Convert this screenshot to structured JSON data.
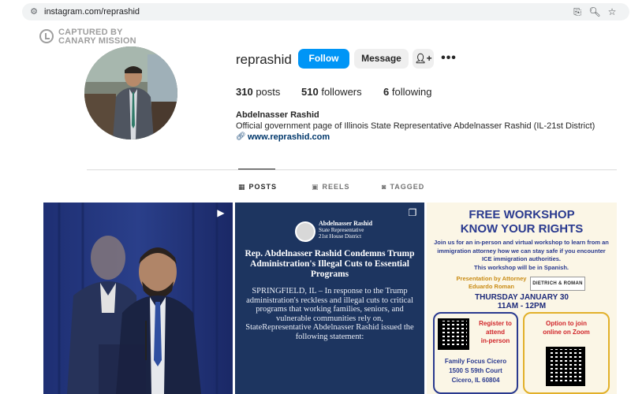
{
  "browser": {
    "url": "instagram.com/reprashid"
  },
  "watermark": {
    "line1": "CAPTURED BY",
    "line2": "CANARY MISSION"
  },
  "profile": {
    "username": "reprashid",
    "follow_label": "Follow",
    "message_label": "Message",
    "posts_count": "310",
    "posts_label": "posts",
    "followers_count": "510",
    "followers_label": "followers",
    "following_count": "6",
    "following_label": "following",
    "full_name": "Abdelnasser Rashid",
    "bio": "Official government page of Illinois State Representative Abdelnasser Rashid (IL-21st District)",
    "link": "www.reprashid.com"
  },
  "tabs": [
    {
      "label": "POSTS",
      "icon": "grid-icon",
      "active": true
    },
    {
      "label": "REELS",
      "icon": "reels-icon",
      "active": false
    },
    {
      "label": "TAGGED",
      "icon": "tagged-icon",
      "active": false
    }
  ],
  "posts": [
    {
      "kind": "reel"
    },
    {
      "kind": "carousel",
      "org_name": "Abdelnasser Rashid",
      "org_role": "State Representative",
      "org_district": "21st House District",
      "title": "Rep. Abdelnasser Rashid Condemns Trump Administration's Illegal Cuts to Essential Programs",
      "body": "SPRINGFIELD, IL – In response to the Trump administration's reckless and illegal cuts to critical programs that working families, seniors, and vulnerable communities rely on, StateRepresentative Abdelnasser Rashid issued the following statement:"
    },
    {
      "kind": "image",
      "heading1": "FREE WORKSHOP",
      "heading2": "KNOW YOUR RIGHTS",
      "intro": "Join us for an in-person and virtual workshop to learn from an immigration attorney how we can stay safe if you encounter ICE immigration authorities.",
      "spanish_note": "This workshop will be in Spanish.",
      "presenter_line1": "Presentation by Attorney",
      "presenter_line2": "Eduardo Roman",
      "firm": "DIETRICH & ROMAN",
      "date_line": "THURSDAY JANUARY 30",
      "time_line": "11AM - 12PM",
      "register_line1": "Register to",
      "register_line2": "attend",
      "register_line3": "in-person",
      "zoom_line1": "Option to join",
      "zoom_line2": "online on Zoom",
      "venue": "Family Focus Cicero",
      "street": "1500 S 59th Court",
      "city": "Cicero, IL 60804"
    }
  ],
  "colors": {
    "follow_blue": "#0095f6",
    "link_blue": "#00376b"
  }
}
